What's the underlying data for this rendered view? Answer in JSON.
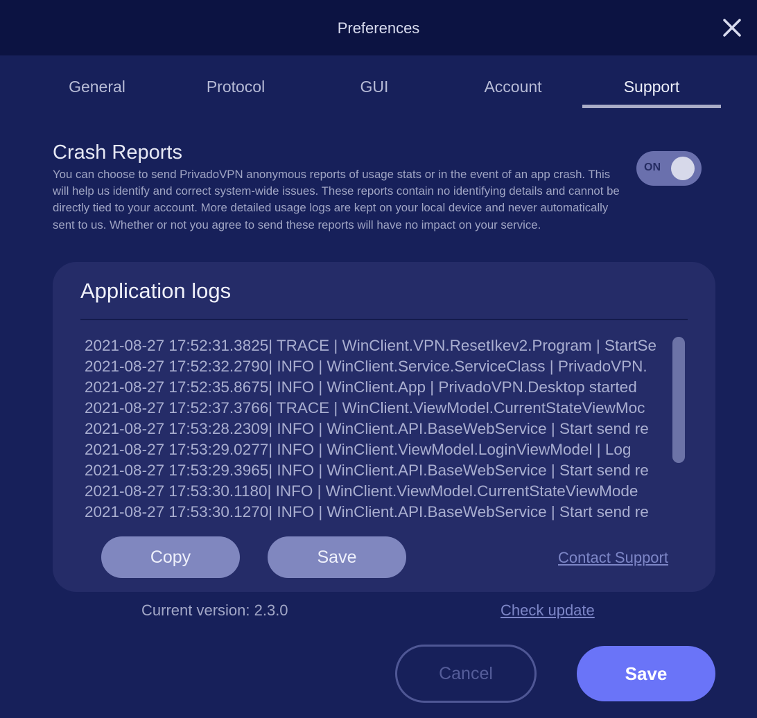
{
  "window": {
    "title": "Preferences"
  },
  "tabs": [
    {
      "label": "General"
    },
    {
      "label": "Protocol"
    },
    {
      "label": "GUI"
    },
    {
      "label": "Account"
    },
    {
      "label": "Support",
      "active": true
    }
  ],
  "crash_reports": {
    "title": "Crash Reports",
    "description": "You can choose to send PrivadoVPN anonymous reports of usage stats or in the event of an app crash. This will help us identify and correct system-wide issues. These reports contain no identifying details and cannot be directly tied to your account. More detailed usage logs are kept on your local device and never automatically sent to us. Whether or not you agree to send these reports will have no impact on your service.",
    "toggle_label": "ON",
    "enabled": true
  },
  "logs": {
    "title": "Application logs",
    "lines": [
      "2021-08-27 17:52:31.3825| TRACE | WinClient.VPN.ResetIkev2.Program | StartSe",
      "2021-08-27 17:52:32.2790|  INFO | WinClient.Service.ServiceClass | PrivadoVPN.",
      "2021-08-27 17:52:35.8675|  INFO | WinClient.App | PrivadoVPN.Desktop started",
      "2021-08-27 17:52:37.3766| TRACE | WinClient.ViewModel.CurrentStateViewMoc",
      "2021-08-27 17:53:28.2309|  INFO | WinClient.API.BaseWebService | Start send re",
      "2021-08-27 17:53:29.0277|  INFO | WinClient.ViewModel.LoginViewModel | Log",
      "2021-08-27 17:53:29.3965|  INFO | WinClient.API.BaseWebService | Start send re",
      "2021-08-27 17:53:30.1180|  INFO | WinClient.ViewModel.CurrentStateViewMode",
      "2021-08-27 17:53:30.1270|  INFO | WinClient.API.BaseWebService | Start send re"
    ],
    "copy_label": "Copy",
    "save_label": "Save",
    "contact_label": "Contact Support"
  },
  "footer": {
    "version_text": "Current version: 2.3.0",
    "check_update_label": "Check update",
    "cancel_label": "Cancel",
    "save_label": "Save"
  },
  "colors": {
    "background": "#17205a",
    "titlebar": "#0c1342",
    "panel": "#252c68",
    "accent": "#6a74f8",
    "pill_button": "#8087bf",
    "link": "#7d86c7"
  },
  "icons": {
    "close": "close-icon"
  }
}
